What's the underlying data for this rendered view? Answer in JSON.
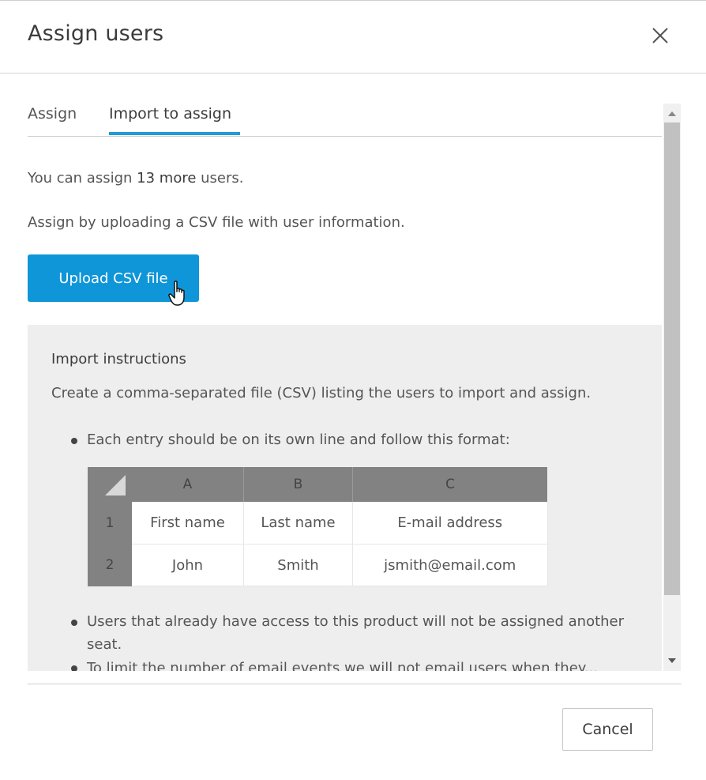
{
  "dialog": {
    "title": "Assign users",
    "close_icon": "close-icon"
  },
  "tabs": [
    {
      "label": "Assign",
      "active": false
    },
    {
      "label": "Import to assign",
      "active": true
    }
  ],
  "info": {
    "prefix": "You can assign ",
    "count": "13 more",
    "suffix": " users.",
    "upload_hint": "Assign by uploading a CSV file with user information."
  },
  "upload_button": "Upload CSV file",
  "instructions": {
    "title": "Import instructions",
    "description": "Create a comma-separated file (CSV) listing the users to import and assign.",
    "bullets": [
      "Each entry should be on its own line and follow this format:",
      "Users that already have access to this product will not be assigned another seat.",
      "To limit the number of email events we will not email users when they..."
    ]
  },
  "format_table": {
    "columns": [
      "A",
      "B",
      "C"
    ],
    "rows": [
      {
        "num": "1",
        "cells": [
          "First name",
          "Last name",
          "E-mail address"
        ]
      },
      {
        "num": "2",
        "cells": [
          "John",
          "Smith",
          "jsmith@email.com"
        ]
      }
    ]
  },
  "footer": {
    "cancel_label": "Cancel"
  },
  "colors": {
    "accent": "#1f9bd9",
    "button": "#0f96d8",
    "panel_bg": "#eeeeee",
    "table_header": "#828282"
  }
}
